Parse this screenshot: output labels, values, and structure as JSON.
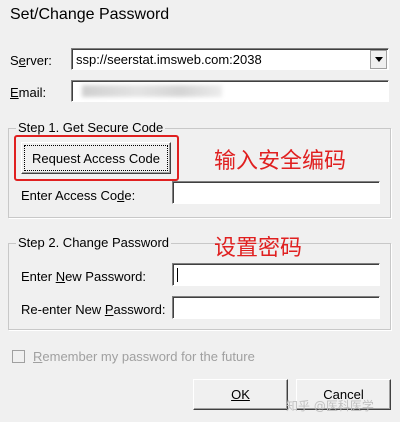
{
  "window": {
    "title": "Set/Change Password"
  },
  "server": {
    "label_pre": "S",
    "label_u": "e",
    "label_post": "rver:",
    "value": "ssp://seerstat.imsweb.com:2038"
  },
  "email": {
    "label_u": "E",
    "label_post": "mail:"
  },
  "step1": {
    "legend": "Step 1. Get Secure Code",
    "request_button": "Request Access Code",
    "access_label_pre": "Enter Access Co",
    "access_label_u": "d",
    "access_label_post": "e:",
    "note": "输入安全编码"
  },
  "step2": {
    "legend": "Step 2. Change Password",
    "new_label_pre": "Enter ",
    "new_label_u": "N",
    "new_label_post": "ew Password:",
    "reenter_label_pre": "Re-enter New ",
    "reenter_label_u": "P",
    "reenter_label_post": "assword:",
    "note": "设置密码"
  },
  "remember": {
    "label_u": "R",
    "label_post": "emember my password for the future"
  },
  "buttons": {
    "ok": "OK",
    "cancel": "Cancel"
  },
  "watermark": "知乎 @医科医学"
}
